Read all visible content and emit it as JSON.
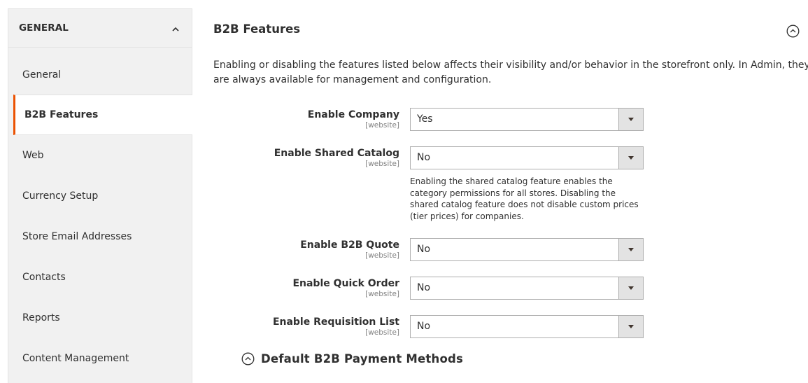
{
  "sidebar": {
    "group_title": "GENERAL",
    "group_icon": "chevron-up-icon",
    "items": [
      {
        "label": "General",
        "active": false
      },
      {
        "label": "B2B Features",
        "active": true
      },
      {
        "label": "Web",
        "active": false
      },
      {
        "label": "Currency Setup",
        "active": false
      },
      {
        "label": "Store Email Addresses",
        "active": false
      },
      {
        "label": "Contacts",
        "active": false
      },
      {
        "label": "Reports",
        "active": false
      },
      {
        "label": "Content Management",
        "active": false
      }
    ],
    "accent_color": "#eb5202"
  },
  "main": {
    "section_title": "B2B Features",
    "collapse_icon": "circle-chevron-up-icon",
    "intro": "Enabling or disabling the features listed below affects their visibility and/or behavior in the storefront only. In Admin, they are always available for management and configuration.",
    "fields": [
      {
        "label": "Enable Company",
        "scope": "[website]",
        "value": "Yes"
      },
      {
        "label": "Enable Shared Catalog",
        "scope": "[website]",
        "value": "No",
        "note": "Enabling the shared catalog feature enables the category permissions for all stores. Disabling the shared catalog feature does not disable custom prices (tier prices) for companies."
      },
      {
        "label": "Enable B2B Quote",
        "scope": "[website]",
        "value": "No"
      },
      {
        "label": "Enable Quick Order",
        "scope": "[website]",
        "value": "No"
      },
      {
        "label": "Enable Requisition List",
        "scope": "[website]",
        "value": "No"
      }
    ],
    "subsection_title": "Default B2B Payment Methods"
  }
}
